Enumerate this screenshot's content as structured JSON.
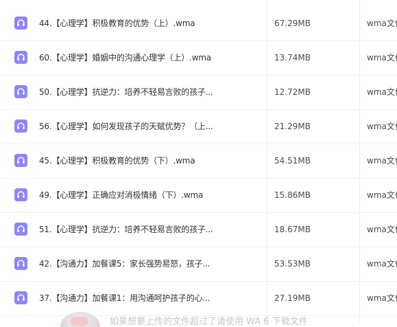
{
  "files": [
    {
      "name": "44.【心理学】积极教育的优势（上）.wma",
      "size": "67.29MB",
      "type": "wma文件"
    },
    {
      "name": "60.【心理学】婚姻中的沟通心理学（上）.wma",
      "size": "13.74MB",
      "type": "wma文件"
    },
    {
      "name": "50.【心理学】抗逆力：培养不轻易言败的孩子...",
      "size": "12.72MB",
      "type": "wma文件"
    },
    {
      "name": "56.【心理学】如何发现孩子的天赋优势？（上...",
      "size": "21.29MB",
      "type": "wma文件"
    },
    {
      "name": "45.【心理学】积极教育的优势（下）.wma",
      "size": "54.51MB",
      "type": "wma文件"
    },
    {
      "name": "49.【心理学】正确应对消极情绪（下）.wma",
      "size": "15.86MB",
      "type": "wma文件"
    },
    {
      "name": "51.【心理学】抗逆力：培养不轻易言败的孩子...",
      "size": "18.67MB",
      "type": "wma文件"
    },
    {
      "name": "42.【沟通力】加餐课5：家长强势易怒，孩子...",
      "size": "53.53MB",
      "type": "wma文件"
    },
    {
      "name": "37.【沟通力】加餐课1：用沟通呵护孩子的心...",
      "size": "27.19MB",
      "type": "wma文件"
    }
  ],
  "file_icon": "audio-headphones-icon",
  "colors": {
    "icon_bg": "#8f86f6",
    "text": "#333333",
    "border": "#f1f1f1"
  },
  "banner": {
    "text": "如果想要上传的文件超过了请使用 WA 6 下载文件"
  }
}
